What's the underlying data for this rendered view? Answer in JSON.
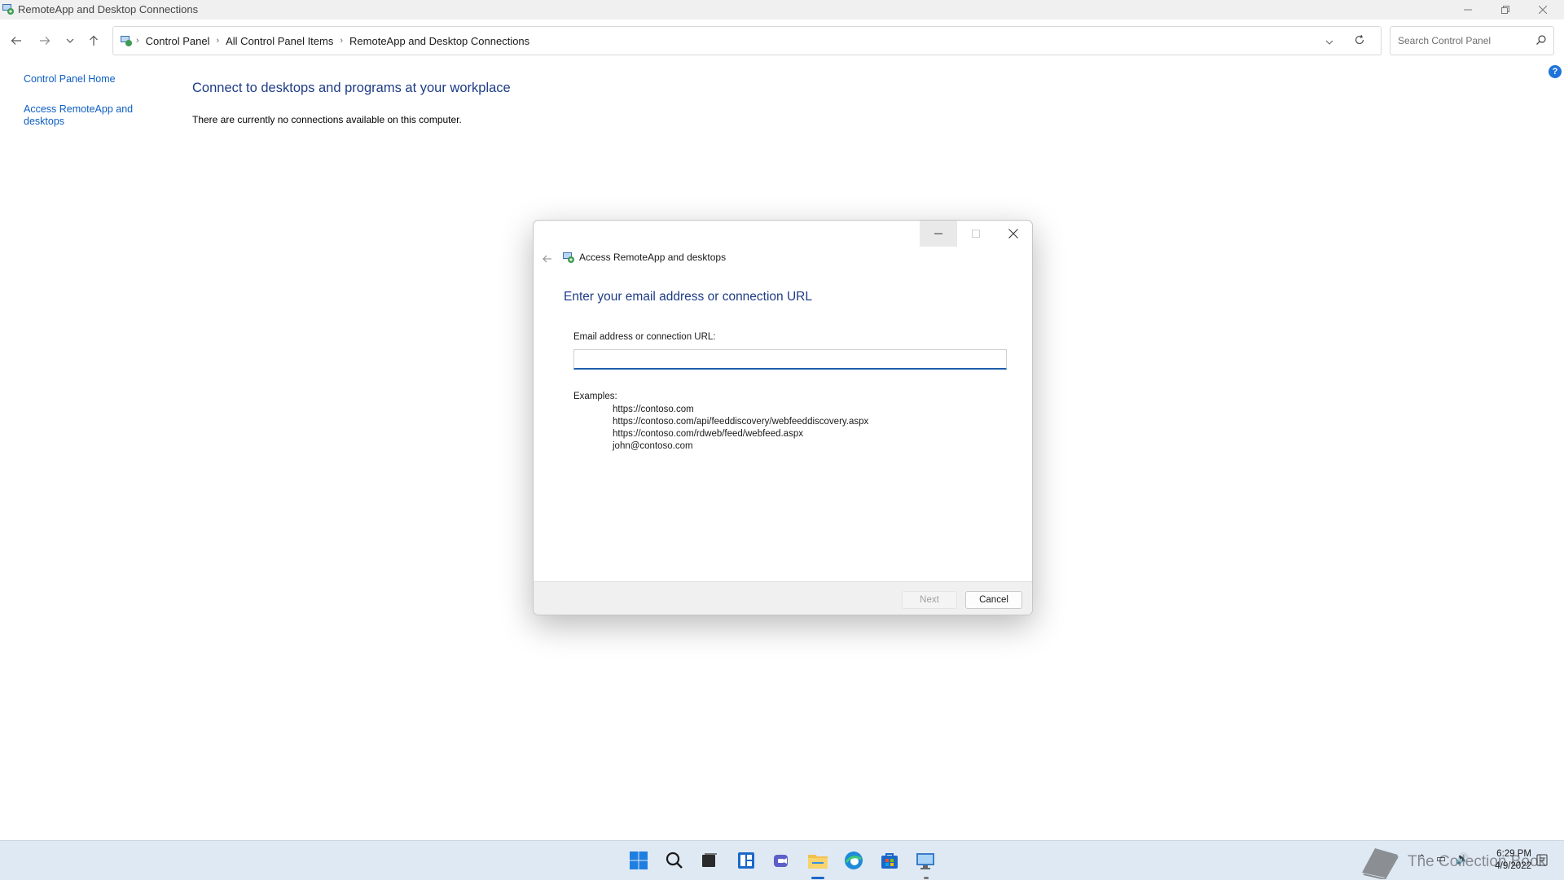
{
  "window": {
    "title": "RemoteApp and Desktop Connections"
  },
  "breadcrumb": {
    "items": [
      "Control Panel",
      "All Control Panel Items",
      "RemoteApp and Desktop Connections"
    ]
  },
  "search": {
    "placeholder": "Search Control Panel"
  },
  "sidebar": {
    "items": [
      {
        "label": "Control Panel Home"
      },
      {
        "label": "Access RemoteApp and desktops"
      }
    ]
  },
  "main": {
    "heading": "Connect to desktops and programs at your workplace",
    "status": "There are currently no connections available on this computer."
  },
  "dialog": {
    "title": "Access RemoteApp and desktops",
    "heading": "Enter your email address or connection URL",
    "field_label": "Email address or connection URL:",
    "field_value": "",
    "examples_label": "Examples:",
    "examples": [
      "https://contoso.com",
      "https://contoso.com/api/feeddiscovery/webfeeddiscovery.aspx",
      "https://contoso.com/rdweb/feed/webfeed.aspx",
      "john@contoso.com"
    ],
    "next_label": "Next",
    "cancel_label": "Cancel"
  },
  "taskbar": {
    "apps": [
      "start-icon",
      "search-icon",
      "task-view-icon",
      "widgets-icon",
      "chat-icon",
      "file-explorer-icon",
      "edge-icon",
      "store-icon",
      "remote-desktop-icon"
    ],
    "clock_time": "6:29 PM",
    "clock_date": "4/9/2022",
    "watermark_text": "The Collection Book"
  },
  "colors": {
    "accent": "#1c5eaa",
    "heading": "#1e3c86",
    "link": "#0d5ec2",
    "taskbar": "#dfe9f4"
  }
}
